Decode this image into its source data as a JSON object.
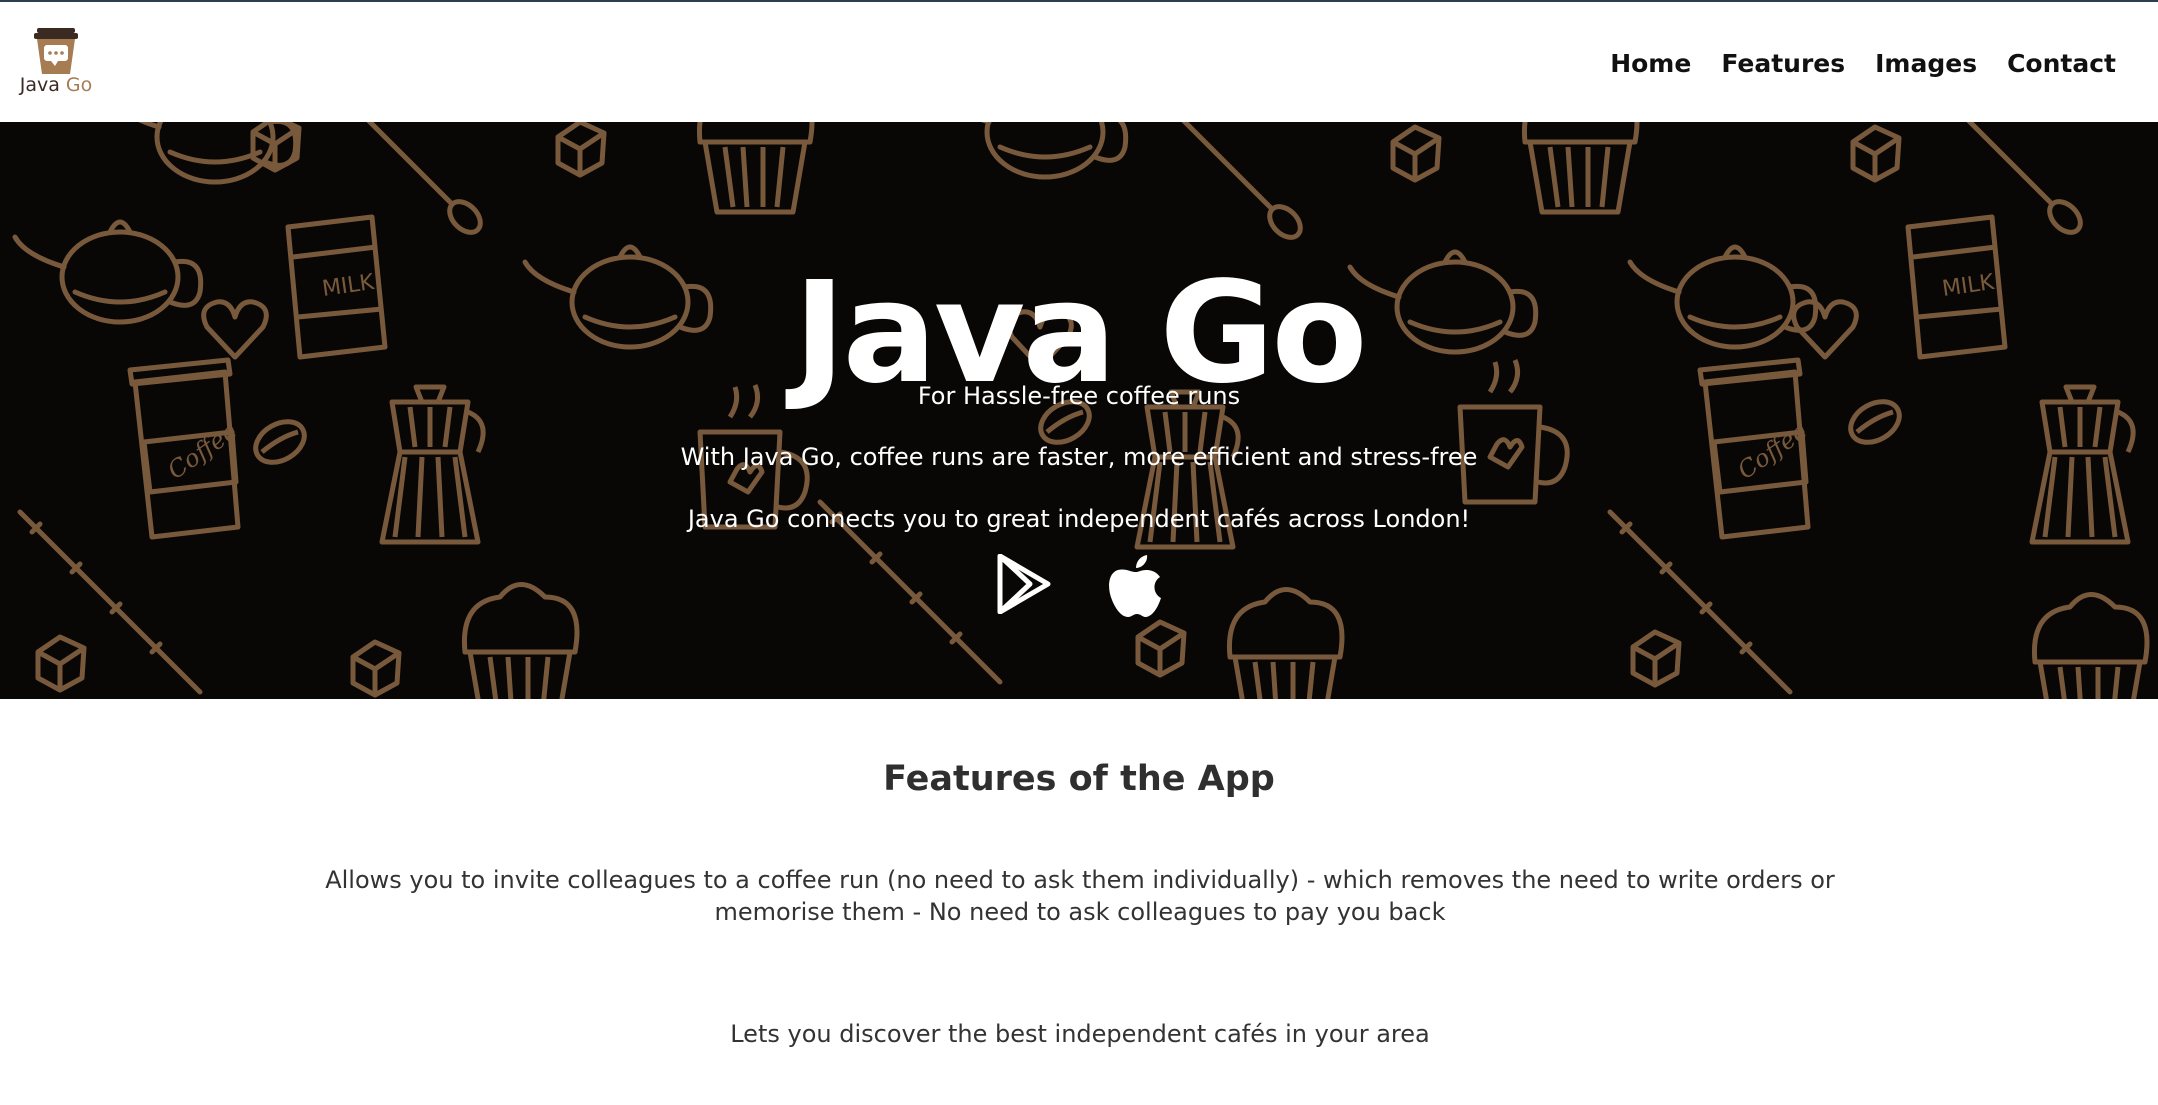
{
  "brand": {
    "name_part1": "Java",
    "name_part2": "Go",
    "logo_icon": "coffee-cup-icon",
    "colors": {
      "dark": "#3a2a22",
      "accent": "#a67c52"
    }
  },
  "nav": {
    "items": [
      {
        "label": "Home"
      },
      {
        "label": "Features"
      },
      {
        "label": "Images"
      },
      {
        "label": "Contact"
      }
    ]
  },
  "hero": {
    "title": "Java Go",
    "tagline": "For Hassle-free coffee runs",
    "line2": "With Java Go, coffee runs are faster, more efficient and stress-free",
    "line3": "Java Go connects you to great independent cafés across London!",
    "background": "coffee doodle pattern",
    "pattern_color": "#a67c52",
    "store_icons": [
      "google-play-icon",
      "apple-icon"
    ]
  },
  "features": {
    "title": "Features of the App",
    "items": [
      "Allows you to invite colleagues to a coffee run (no need to ask them individually) - which removes the need to write orders or memorise them - No need to ask colleagues to pay you back",
      "Lets you discover the best independent cafés in your area"
    ]
  }
}
